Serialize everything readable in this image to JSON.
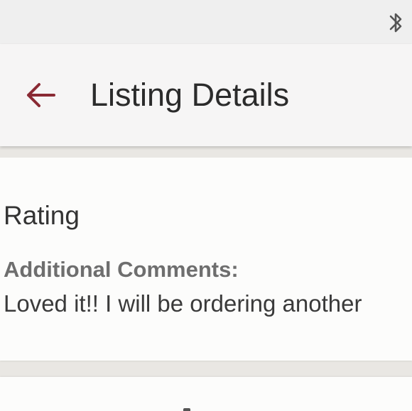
{
  "status_bar": {
    "icons": [
      "bluetooth-icon"
    ]
  },
  "app_bar": {
    "back_icon": "arrow-left-icon",
    "title": "Listing Details",
    "accent_color": "#8a2a34"
  },
  "review_card": {
    "rating_label": "Rating",
    "comments_heading": "Additional Comments:",
    "comments_text": "Loved it!! I will be ordering another"
  }
}
